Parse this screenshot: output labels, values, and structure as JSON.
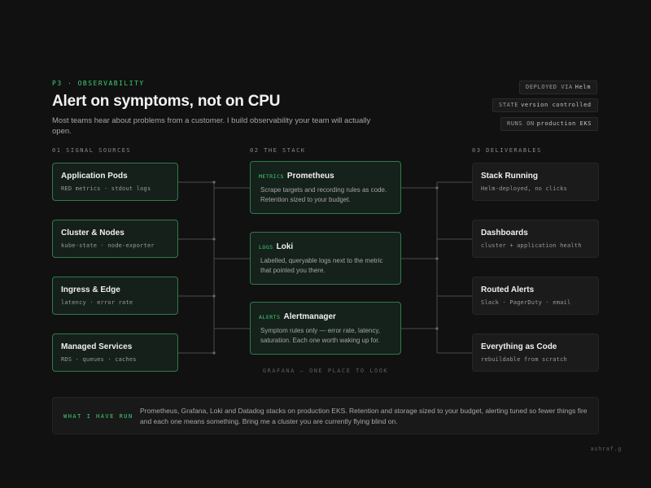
{
  "eyebrow": "P3 · OBSERVABILITY",
  "title": "Alert on symptoms, not on CPU",
  "subtitle": "Most teams hear about problems from a customer. I build observability your team will actually open.",
  "badges": [
    {
      "label": "DEPLOYED VIA",
      "value": "Helm"
    },
    {
      "label": "STATE",
      "value": "version controlled"
    },
    {
      "label": "RUNS ON",
      "value": "production EKS"
    }
  ],
  "columns": {
    "sources": "01  SIGNAL SOURCES",
    "stack": "02  THE STACK",
    "deliverables": "03  DELIVERABLES"
  },
  "sources": [
    {
      "title": "Application Pods",
      "sub": "RED metrics · stdout logs"
    },
    {
      "title": "Cluster & Nodes",
      "sub": "kube-state · node-exporter"
    },
    {
      "title": "Ingress & Edge",
      "sub": "latency · error rate"
    },
    {
      "title": "Managed Services",
      "sub": "RDS · queues · caches"
    }
  ],
  "stack": [
    {
      "tag": "METRICS",
      "title": "Prometheus",
      "desc": "Scrape targets and recording rules as code. Retention sized to your budget."
    },
    {
      "tag": "LOGS",
      "title": "Loki",
      "desc": "Labelled, queryable logs next to the metric that pointed you there."
    },
    {
      "tag": "ALERTS",
      "title": "Alertmanager",
      "desc": "Symptom rules only — error rate, latency, saturation. Each one worth waking up for."
    }
  ],
  "stack_caption": "GRAFANA — ONE PLACE TO LOOK",
  "deliverables": [
    {
      "title": "Stack Running",
      "sub": "Helm-deployed, no clicks"
    },
    {
      "title": "Dashboards",
      "sub": "cluster + application health"
    },
    {
      "title": "Routed Alerts",
      "sub": "Slack · PagerDuty · email"
    },
    {
      "title": "Everything as Code",
      "sub": "rebuildable from scratch"
    }
  ],
  "footer": {
    "label": "WHAT I HAVE RUN",
    "text": "Prometheus, Grafana, Loki and Datadog stacks on production EKS. Retention and storage sized to your budget, alerting tuned so fewer things fire and each one means something. Bring me a cluster you are currently flying blind on."
  },
  "signature": "ashraf.g",
  "colors": {
    "background": "#111111",
    "accent_green": "#3ecf72",
    "card_border_green": "#2f7a4c",
    "connector": "#4a4a4a"
  }
}
